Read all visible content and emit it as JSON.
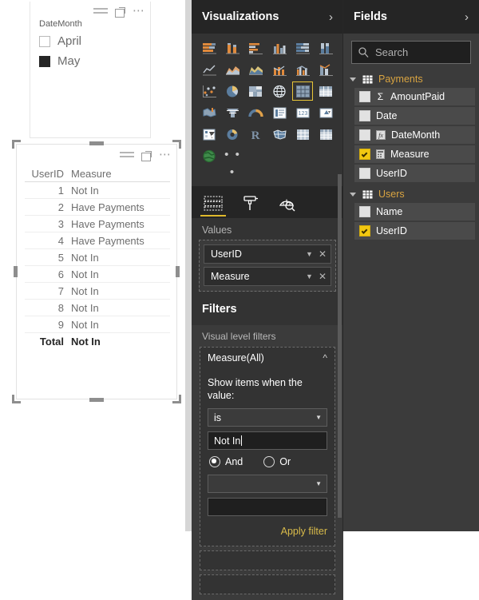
{
  "report": {
    "slicer": {
      "title": "DateMonth",
      "icons": [
        "slicer-list-icon",
        "focus-mode-icon",
        "more-options-icon"
      ],
      "items": [
        {
          "label": "April",
          "checked": false
        },
        {
          "label": "May",
          "checked": true
        }
      ]
    },
    "table_visual": {
      "icons": [
        "filter-bars-icon",
        "focus-mode-icon",
        "more-options-icon"
      ],
      "columns": [
        "UserID",
        "Measure"
      ],
      "rows": [
        {
          "userid": "1",
          "measure": "Not In"
        },
        {
          "userid": "2",
          "measure": "Have Payments"
        },
        {
          "userid": "3",
          "measure": "Have Payments"
        },
        {
          "userid": "4",
          "measure": "Have Payments"
        },
        {
          "userid": "5",
          "measure": "Not In"
        },
        {
          "userid": "6",
          "measure": "Not In"
        },
        {
          "userid": "7",
          "measure": "Not In"
        },
        {
          "userid": "8",
          "measure": "Not In"
        },
        {
          "userid": "9",
          "measure": "Not In"
        }
      ],
      "total": {
        "userid": "Total",
        "measure": "Not In"
      }
    }
  },
  "visualizations": {
    "title": "Visualizations",
    "expand_icon": "chevron-right-icon",
    "gallery_more": "• • •",
    "selected_visual": "table-visual-icon",
    "tabs": [
      {
        "name": "fields-tab",
        "active": true
      },
      {
        "name": "format-tab",
        "active": false
      },
      {
        "name": "analytics-tab",
        "active": false
      }
    ],
    "values": {
      "label": "Values",
      "fields": [
        {
          "name": "UserID"
        },
        {
          "name": "Measure"
        }
      ]
    },
    "filters": {
      "title": "Filters",
      "section_label": "Visual level filters",
      "card": {
        "title": "Measure(All)",
        "collapse_icon": "chevron-up-icon",
        "condition_label": "Show items when the value:",
        "operator_1": "is",
        "value_1": "Not In",
        "conjunction": [
          {
            "label": "And",
            "selected": true
          },
          {
            "label": "Or",
            "selected": false
          }
        ],
        "operator_2": "",
        "value_2": "",
        "apply_label": "Apply filter"
      }
    },
    "accent_color": "#e0b92c",
    "highlight_color": "#ee2b26"
  },
  "fields": {
    "title": "Fields",
    "expand_icon": "chevron-right-icon",
    "search": {
      "placeholder": "Search",
      "value": "",
      "icon": "search-icon"
    },
    "tables": [
      {
        "name": "Payments",
        "expanded": true,
        "fields": [
          {
            "name": "AmountPaid",
            "checked": false,
            "type_icon": "sum-sigma-icon"
          },
          {
            "name": "Date",
            "checked": false,
            "type_icon": ""
          },
          {
            "name": "DateMonth",
            "checked": false,
            "type_icon": "calculated-column-icon"
          },
          {
            "name": "Measure",
            "checked": true,
            "type_icon": "measure-icon"
          },
          {
            "name": "UserID",
            "checked": false,
            "type_icon": ""
          }
        ]
      },
      {
        "name": "Users",
        "expanded": true,
        "fields": [
          {
            "name": "Name",
            "checked": false,
            "type_icon": ""
          },
          {
            "name": "UserID",
            "checked": true,
            "type_icon": ""
          }
        ]
      }
    ],
    "table_color": "#d9a441",
    "checked_color": "#f2c811"
  }
}
